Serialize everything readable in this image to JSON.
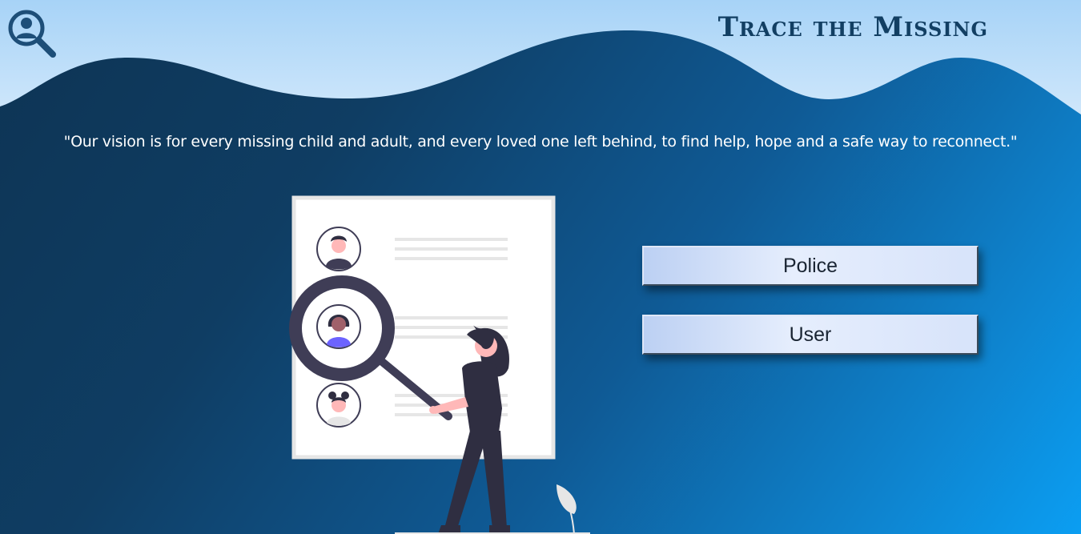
{
  "header": {
    "brand": "Trace the Missing",
    "logo_icon": "person-search-icon"
  },
  "vision": {
    "quote": "\"Our vision is for every missing child and adult, and every loved one left behind, to find help, hope and a safe way to reconnect.\""
  },
  "illustration": {
    "icon": "profile-search-illustration"
  },
  "roles": {
    "police_label": "Police",
    "user_label": "User"
  },
  "colors": {
    "brand_text": "#123f63",
    "sky_top": "#a9d5f7",
    "gradient_dark": "#0d3454",
    "gradient_light": "#0b9ef2",
    "button_face": "#e6eefd",
    "figure_dark": "#2f2e41",
    "magnifier": "#3f3d56"
  }
}
